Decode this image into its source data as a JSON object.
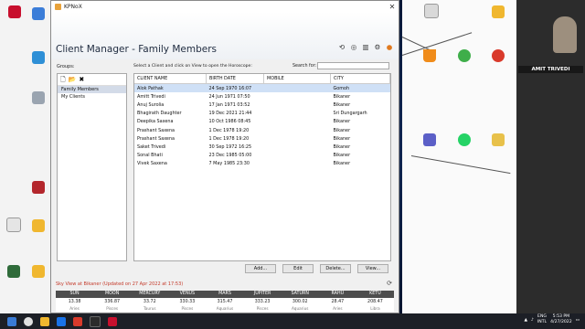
{
  "window": {
    "app_title": "KPNoX",
    "close_glyph": "✕"
  },
  "header": {
    "title": "Client Manager - Family Members"
  },
  "groups": {
    "label": "Groups:",
    "items": [
      "Family Members",
      "My Clients"
    ],
    "selected_index": 0
  },
  "list": {
    "instruction": "Select a Client and click on View to open the Horoscope:",
    "search_label": "Search for:",
    "search_value": "",
    "columns": [
      "CLIENT NAME",
      "BIRTH DATE",
      "MOBILE",
      "CITY"
    ],
    "selected_index": 0,
    "rows": [
      [
        "Alok Pathak",
        "24 Sep 1970 16:07",
        "",
        "Gomoh"
      ],
      [
        "Amitt Trivedi",
        "24 Jun 1971 07:50",
        "",
        "Bikaner"
      ],
      [
        "Anuj Surolia",
        "17 Jan 1971 03:52",
        "",
        "Bikaner"
      ],
      [
        "Bhagirath Daughter",
        "19 Dec 2021 21:44",
        "",
        "Sri Dungargarh"
      ],
      [
        "Deepika Saxena",
        "10 Oct 1986 08:45",
        "",
        "Bikaner"
      ],
      [
        "Prashant Saxena",
        "1 Dec 1978 19:20",
        "",
        "Bikaner"
      ],
      [
        "Prashant Saxena",
        "1 Dec 1978 19:20",
        "",
        "Bikaner"
      ],
      [
        "Saket Trivedi",
        "30 Sep 1972 16:25",
        "",
        "Bikaner"
      ],
      [
        "Sonal Bhati",
        "23 Dec 1985 05:00",
        "",
        "Bikaner"
      ],
      [
        "Vivek Saxena",
        "7 May 1985 23:30",
        "",
        "Bikaner"
      ]
    ]
  },
  "buttons": {
    "add": "Add...",
    "edit": "Edit",
    "delete": "Delete...",
    "view": "View..."
  },
  "sky": {
    "caption": "Sky View at Bikaner (Updated on 27 Apr 2022 at 17:53)",
    "planets": [
      "SUN",
      "MOON",
      "MERCURY",
      "VENUS",
      "MARS",
      "JUPITER",
      "SATURN",
      "RAHU",
      "KETU"
    ],
    "values": [
      "13.38",
      "336.87",
      "33.72",
      "330.33",
      "315.47",
      "333.23",
      "300.02",
      "28.47",
      "208.47"
    ],
    "signs": [
      "Aries",
      "Pisces",
      "Taurus",
      "Pisces",
      "Aquarius",
      "Pisces",
      "Aquarius",
      "Aries",
      "Libra"
    ]
  },
  "video": {
    "name": "AMIT TRIVEDI"
  },
  "tray": {
    "lang_line1": "ENG",
    "lang_line2": "INTL",
    "time": "5:53 PM",
    "date": "4/27/2022"
  },
  "colors": {
    "selection": "#cfe0f6",
    "sky_header": "#4d4d4d",
    "caption_red": "#c43a2a",
    "accent": "#e8a23a"
  }
}
